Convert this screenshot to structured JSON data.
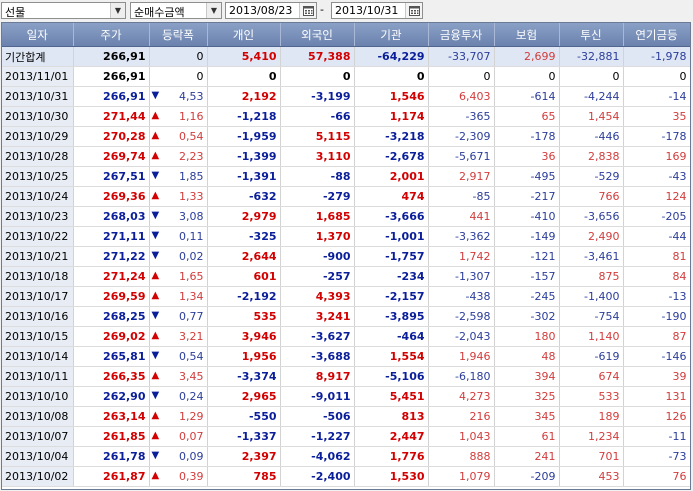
{
  "toolbar": {
    "market": "선물",
    "metric": "순매수금액",
    "date_from": "2013/08/23",
    "date_to": "2013/10/31",
    "separator": "-"
  },
  "table": {
    "headers": [
      "일자",
      "주가",
      "등락폭",
      "개인",
      "외국인",
      "기관",
      "금융투자",
      "보험",
      "투신",
      "연기금등"
    ],
    "summary": {
      "date": "기간합계",
      "price": "266,91",
      "chg": "0",
      "dir": "",
      "indiv": "5,410",
      "foreign": "57,388",
      "inst": "-64,229",
      "fin": "-33,707",
      "ins": "2,699",
      "trust": "-32,881",
      "pension": "-1,978"
    },
    "rows": [
      {
        "date": "2013/11/01",
        "price": "266,91",
        "dir": "",
        "chg": "0",
        "indiv": "0",
        "foreign": "0",
        "inst": "0",
        "fin": "0",
        "ins": "0",
        "trust": "0",
        "pension": "0"
      },
      {
        "date": "2013/10/31",
        "price": "266,91",
        "dir": "down",
        "chg": "4,53",
        "indiv": "2,192",
        "foreign": "-3,199",
        "inst": "1,546",
        "fin": "6,403",
        "ins": "-614",
        "trust": "-4,244",
        "pension": "-14"
      },
      {
        "date": "2013/10/30",
        "price": "271,44",
        "dir": "up",
        "chg": "1,16",
        "indiv": "-1,218",
        "foreign": "-66",
        "inst": "1,174",
        "fin": "-365",
        "ins": "65",
        "trust": "1,454",
        "pension": "35"
      },
      {
        "date": "2013/10/29",
        "price": "270,28",
        "dir": "up",
        "chg": "0,54",
        "indiv": "-1,959",
        "foreign": "5,115",
        "inst": "-3,218",
        "fin": "-2,309",
        "ins": "-178",
        "trust": "-446",
        "pension": "-178"
      },
      {
        "date": "2013/10/28",
        "price": "269,74",
        "dir": "up",
        "chg": "2,23",
        "indiv": "-1,399",
        "foreign": "3,110",
        "inst": "-2,678",
        "fin": "-5,671",
        "ins": "36",
        "trust": "2,838",
        "pension": "169"
      },
      {
        "date": "2013/10/25",
        "price": "267,51",
        "dir": "down",
        "chg": "1,85",
        "indiv": "-1,391",
        "foreign": "-88",
        "inst": "2,001",
        "fin": "2,917",
        "ins": "-495",
        "trust": "-529",
        "pension": "-43"
      },
      {
        "date": "2013/10/24",
        "price": "269,36",
        "dir": "up",
        "chg": "1,33",
        "indiv": "-632",
        "foreign": "-279",
        "inst": "474",
        "fin": "-85",
        "ins": "-217",
        "trust": "766",
        "pension": "124"
      },
      {
        "date": "2013/10/23",
        "price": "268,03",
        "dir": "down",
        "chg": "3,08",
        "indiv": "2,979",
        "foreign": "1,685",
        "inst": "-3,666",
        "fin": "441",
        "ins": "-410",
        "trust": "-3,656",
        "pension": "-205"
      },
      {
        "date": "2013/10/22",
        "price": "271,11",
        "dir": "down",
        "chg": "0,11",
        "indiv": "-325",
        "foreign": "1,370",
        "inst": "-1,001",
        "fin": "-3,362",
        "ins": "-149",
        "trust": "2,490",
        "pension": "-44"
      },
      {
        "date": "2013/10/21",
        "price": "271,22",
        "dir": "down",
        "chg": "0,02",
        "indiv": "2,644",
        "foreign": "-900",
        "inst": "-1,757",
        "fin": "1,742",
        "ins": "-121",
        "trust": "-3,461",
        "pension": "81"
      },
      {
        "date": "2013/10/18",
        "price": "271,24",
        "dir": "up",
        "chg": "1,65",
        "indiv": "601",
        "foreign": "-257",
        "inst": "-234",
        "fin": "-1,307",
        "ins": "-157",
        "trust": "875",
        "pension": "84"
      },
      {
        "date": "2013/10/17",
        "price": "269,59",
        "dir": "up",
        "chg": "1,34",
        "indiv": "-2,192",
        "foreign": "4,393",
        "inst": "-2,157",
        "fin": "-438",
        "ins": "-245",
        "trust": "-1,400",
        "pension": "-13"
      },
      {
        "date": "2013/10/16",
        "price": "268,25",
        "dir": "down",
        "chg": "0,77",
        "indiv": "535",
        "foreign": "3,241",
        "inst": "-3,895",
        "fin": "-2,598",
        "ins": "-302",
        "trust": "-754",
        "pension": "-190"
      },
      {
        "date": "2013/10/15",
        "price": "269,02",
        "dir": "up",
        "chg": "3,21",
        "indiv": "3,946",
        "foreign": "-3,627",
        "inst": "-464",
        "fin": "-2,043",
        "ins": "180",
        "trust": "1,140",
        "pension": "87"
      },
      {
        "date": "2013/10/14",
        "price": "265,81",
        "dir": "down",
        "chg": "0,54",
        "indiv": "1,956",
        "foreign": "-3,688",
        "inst": "1,554",
        "fin": "1,946",
        "ins": "48",
        "trust": "-619",
        "pension": "-146"
      },
      {
        "date": "2013/10/11",
        "price": "266,35",
        "dir": "up",
        "chg": "3,45",
        "indiv": "-3,374",
        "foreign": "8,917",
        "inst": "-5,106",
        "fin": "-6,180",
        "ins": "394",
        "trust": "674",
        "pension": "39"
      },
      {
        "date": "2013/10/10",
        "price": "262,90",
        "dir": "down",
        "chg": "0,24",
        "indiv": "2,965",
        "foreign": "-9,011",
        "inst": "5,451",
        "fin": "4,273",
        "ins": "325",
        "trust": "533",
        "pension": "131"
      },
      {
        "date": "2013/10/08",
        "price": "263,14",
        "dir": "up",
        "chg": "1,29",
        "indiv": "-550",
        "foreign": "-506",
        "inst": "813",
        "fin": "216",
        "ins": "345",
        "trust": "189",
        "pension": "126"
      },
      {
        "date": "2013/10/07",
        "price": "261,85",
        "dir": "up",
        "chg": "0,07",
        "indiv": "-1,337",
        "foreign": "-1,227",
        "inst": "2,447",
        "fin": "1,043",
        "ins": "61",
        "trust": "1,234",
        "pension": "-11"
      },
      {
        "date": "2013/10/04",
        "price": "261,78",
        "dir": "down",
        "chg": "0,09",
        "indiv": "2,397",
        "foreign": "-4,062",
        "inst": "1,776",
        "fin": "888",
        "ins": "241",
        "trust": "701",
        "pension": "-73"
      },
      {
        "date": "2013/10/02",
        "price": "261,87",
        "dir": "up",
        "chg": "0,39",
        "indiv": "785",
        "foreign": "-2,400",
        "inst": "1,530",
        "fin": "1,079",
        "ins": "-209",
        "trust": "453",
        "pension": "76"
      }
    ]
  },
  "colors": {
    "up": "#d20000",
    "down": "#0a1e9a",
    "header": "#7389b6",
    "date_bg": "#e8ecf4"
  },
  "icons": {
    "dropdown": "chevron-down-icon",
    "calendar": "calendar-icon",
    "up": "triangle-up-icon",
    "down": "triangle-down-icon"
  }
}
